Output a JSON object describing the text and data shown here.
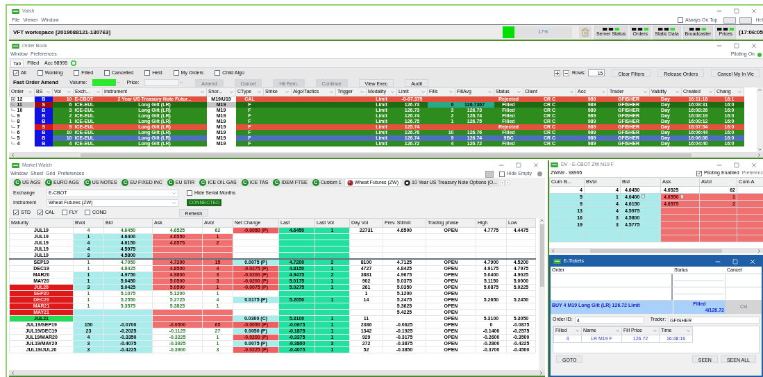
{
  "app": {
    "title": "Vatsh",
    "menu": [
      "File",
      "Viewer",
      "Window"
    ],
    "always_on_top": {
      "label": "Always On Top",
      "checked": false
    },
    "help": "Hel"
  },
  "workspace": {
    "title": "VFT workspace [2019088121-130763]",
    "progress": {
      "level": 0.17,
      "text": "17%"
    },
    "status_buttons": [
      "Server Status",
      "Orders",
      "Static Data",
      "Broadcaster",
      "Prices"
    ],
    "clock": "[17:06:05"
  },
  "order_book": {
    "title": "Order Book",
    "menu": [
      "Window",
      "Preferences"
    ],
    "piloting": "Piloting On",
    "tabs": [
      {
        "label": "Tab",
        "selected": true
      },
      {
        "label": "Filled",
        "selected": false
      },
      {
        "label": "Acc 98995",
        "selected": false
      }
    ],
    "filters": [
      {
        "label": "All",
        "checked": true
      },
      {
        "label": "Working",
        "checked": false
      },
      {
        "label": "Filled",
        "checked": false
      },
      {
        "label": "Cancelled",
        "checked": false
      },
      {
        "label": "Held",
        "checked": false
      },
      {
        "label": "My Orders",
        "checked": false
      },
      {
        "label": "Child Algo",
        "checked": false
      }
    ],
    "rows_label": "Rows:",
    "rows_value": "15",
    "right_buttons": [
      "Clear Filters",
      "Release Orders",
      "Cancel My In Vie"
    ],
    "amend": {
      "title": "Fast Order Amend",
      "volume_label": "Volume:",
      "price_label": "Price:",
      "buttons": [
        {
          "label": "Amend",
          "disabled": true
        },
        {
          "label": "Cancel",
          "disabled": true
        },
        {
          "label": "Hit Rem.",
          "disabled": true
        },
        {
          "label": "Continue",
          "disabled": true
        },
        {
          "label": "View Exec",
          "disabled": false
        },
        {
          "label": "Audit",
          "disabled": false
        }
      ]
    },
    "columns": [
      "Order",
      "BS",
      "Vol",
      "Exch...",
      "Instrument",
      "Shor...",
      "CType",
      "Strike",
      "Algo/Tactics",
      "Trigger",
      "Modality",
      "Limit",
      "Fills",
      "FillAvg",
      "Status",
      "Client",
      "Acc",
      "Trader",
      "Validity",
      "Created",
      "Chang"
    ],
    "rows": [
      {
        "kind": "rejected",
        "selected": false,
        "sell": false,
        "expander": true,
        "order": "12",
        "bs": "B",
        "vol": "10",
        "exch": "E-CBOT",
        "instrument": "2 Year US Treasury Note Futur...",
        "short": "M19/U19",
        "ctype": "CAL",
        "modality": "Limit",
        "limit": "-0-07.375",
        "status": "Rejected",
        "client": "CR C",
        "acc": "989",
        "trader": "GFISHER",
        "validity": "Day",
        "created": "16:11:18",
        "changed": "16:1"
      },
      {
        "kind": "filled",
        "selected": true,
        "sell": true,
        "expander": false,
        "order": "11",
        "bs": "S",
        "vol": "6",
        "exch": "ICE-EUL",
        "instrument": "Long Gilt (LR)",
        "short": "M19",
        "ctype": "F",
        "modality": "Limit",
        "limit": "126.73",
        "fills": "6",
        "fill_avg": "126.7367",
        "status": "Filled",
        "client": "CR C",
        "acc": "989",
        "trader": "GFISHER",
        "validity": "Day",
        "created": "16:08:31",
        "changed": "16:0"
      },
      {
        "kind": "filled",
        "selected": false,
        "sell": false,
        "expander": false,
        "order": "10",
        "bs": "B",
        "vol": "3",
        "exch": "ICE-EUL",
        "instrument": "Long Gilt (LR)",
        "short": "M19",
        "ctype": "F",
        "modality": "Limit",
        "limit": "126.73",
        "fills": "3",
        "fill_avg": "126.73",
        "status": "Filled",
        "client": "CR C",
        "acc": "989",
        "trader": "GFISHER",
        "validity": "Day",
        "created": "16:08:26",
        "changed": "16:0"
      },
      {
        "kind": "filled",
        "selected": false,
        "sell": false,
        "expander": false,
        "order": "9",
        "bs": "B",
        "vol": "2",
        "exch": "ICE-EUL",
        "instrument": "Long Gilt (LR)",
        "short": "M19",
        "ctype": "F",
        "modality": "Limit",
        "limit": "126.74",
        "fills": "2",
        "fill_avg": "126.74",
        "status": "Filled",
        "client": "CR C",
        "acc": "989",
        "trader": "GFISHER",
        "validity": "Day",
        "created": "16:08:19",
        "changed": "16:0"
      },
      {
        "kind": "filled",
        "selected": false,
        "sell": false,
        "expander": false,
        "order": "8",
        "bs": "B",
        "vol": "1",
        "exch": "ICE-EUL",
        "instrument": "Long Gilt (LR)",
        "short": "M19",
        "ctype": "F",
        "modality": "Limit",
        "limit": "126.75",
        "fills": "1",
        "fill_avg": "126.75",
        "status": "Filled",
        "client": "CR C",
        "acc": "989",
        "trader": "GFISHER",
        "validity": "Day",
        "created": "16:08:12",
        "changed": "16:0"
      },
      {
        "kind": "rejected",
        "selected": false,
        "sell": true,
        "expander": false,
        "order": "7",
        "bs": "S",
        "vol": "9",
        "exch": "ICE-EUL",
        "instrument": "Long Gilt (LR)",
        "short": "M19",
        "ctype": "F",
        "modality": "Limit",
        "limit": "125.74",
        "status": "Rejected",
        "client": "CR C",
        "acc": "989",
        "trader": "GFISHER",
        "validity": "Day",
        "created": "16:07:54",
        "changed": "16:0"
      },
      {
        "kind": "filled",
        "selected": false,
        "sell": false,
        "expander": false,
        "order": "6",
        "bs": "B",
        "vol": "10",
        "exch": "ICE-EUL",
        "instrument": "Long Gilt (LR)",
        "short": "M19",
        "ctype": "F",
        "modality": "Limit",
        "limit": "126.76",
        "fills": "10",
        "fill_avg": "126.76",
        "status": "Filled",
        "client": "CR C",
        "acc": "989",
        "trader": "GFISHER",
        "validity": "Day",
        "created": "16:06:44",
        "changed": "16:0"
      },
      {
        "kind": "working",
        "selected": false,
        "sell": false,
        "expander": false,
        "order": "5",
        "bs": "B",
        "vol": "10",
        "exch": "ICE-EUL",
        "instrument": "Long Gilt (LR)",
        "short": "M19",
        "ctype": "F",
        "modality": "Limit",
        "limit": "126.74",
        "fills": "9",
        "fill_avg": "126.74",
        "status": "9BC",
        "client": "CR C",
        "acc": "989",
        "trader": "GFISHER",
        "validity": "Day",
        "created": "16:06:08",
        "changed": "16:0"
      },
      {
        "kind": "filled",
        "selected": false,
        "sell": false,
        "expander": false,
        "order": "4",
        "bs": "B",
        "vol": "4",
        "exch": "ICE-EUL",
        "instrument": "Long Gilt (LR)",
        "short": "M19",
        "ctype": "F",
        "modality": "Limit",
        "limit": "126.72",
        "fills": "4",
        "fill_avg": "126.72",
        "status": "Filled",
        "client": "CR C",
        "acc": "989",
        "trader": "GFISHER",
        "validity": "Day",
        "created": "16:04:40",
        "changed": "16:0"
      }
    ]
  },
  "market_watch": {
    "title": "Market Watch",
    "menu": [
      "Window",
      "Sheet",
      "Grid",
      "Preferences"
    ],
    "hide_empty": {
      "label": "Hide Empty",
      "checked": false
    },
    "tabs": [
      {
        "kind": "letter",
        "badge": "C",
        "label": "US AGS",
        "selected": false
      },
      {
        "kind": "letter",
        "badge": "C",
        "label": "EURO AGS",
        "selected": false
      },
      {
        "kind": "letter",
        "badge": "C",
        "label": "US NOTES",
        "selected": false
      },
      {
        "kind": "letter",
        "badge": "C",
        "label": "EU FIXED INC",
        "selected": false
      },
      {
        "kind": "letter",
        "badge": "C",
        "label": "EU STIR",
        "selected": false
      },
      {
        "kind": "letter",
        "badge": "C",
        "label": "ICE OIL GAS",
        "selected": false
      },
      {
        "kind": "letter",
        "badge": "C",
        "label": "ICE TAS",
        "selected": false
      },
      {
        "kind": "letter",
        "badge": "C",
        "label": "IDEM FTSE",
        "selected": false
      },
      {
        "kind": "letter",
        "badge": "C",
        "label": "Custom 1",
        "selected": false
      },
      {
        "kind": "ball",
        "label": "Wheat Futures (ZW)",
        "selected": true
      },
      {
        "kind": "dot",
        "label": "10 Year US Treasury Note Options (O...",
        "selected": false
      }
    ],
    "exchange_label": "Exchange",
    "exchange": "E-CBOT",
    "instrument_label": "Instrument",
    "instrument": "Wheat Futures (ZW)",
    "hide_serial": {
      "label": "Hide Serial Months",
      "checked": false
    },
    "connection": "CONNECTED",
    "types": [
      {
        "label": "STD",
        "checked": true
      },
      {
        "label": "CAL",
        "checked": true
      },
      {
        "label": "FLY",
        "checked": false
      },
      {
        "label": "COND",
        "checked": false
      }
    ],
    "refresh": "Refresh",
    "columns": [
      "Maturity",
      "BVol",
      "Bid",
      "Ask",
      "AVol",
      "Net Change",
      "Last",
      "Last Vol",
      "Day Vol",
      "Prev. Stlmnt",
      "Trading phase",
      "High",
      "Low"
    ],
    "groups": [
      {
        "rows": [
          {
            "alert": false,
            "new": false,
            "bid_highlight": false,
            "ask_highlight": false,
            "net_up": false,
            "net_down": true,
            "maturity": "JUL19",
            "bvol": "4",
            "bid": "4.6450",
            "ask": "4.6525",
            "avol": "62",
            "net": "-0.0050 (P)",
            "last": "4.6450",
            "last_vol": "1",
            "day_vol": "22731",
            "prev": "4.6500",
            "phase": "OPEN",
            "high": "4.7775",
            "low": "4.4475"
          },
          {
            "alert": false,
            "new": false,
            "bid_highlight": true,
            "ask_highlight": true,
            "net_up": false,
            "net_down": false,
            "maturity": "JUL19",
            "bvol": "1",
            "bid": "4.6400",
            "ask": "4.6550",
            "avol": "1"
          },
          {
            "alert": false,
            "new": false,
            "bid_highlight": true,
            "ask_highlight": true,
            "net_up": false,
            "net_down": false,
            "maturity": "JUL19",
            "bvol": "4",
            "bid": "4.6150",
            "ask": "4.6575",
            "avol": "2"
          },
          {
            "alert": false,
            "new": false,
            "bid_highlight": true,
            "ask_highlight": true,
            "net_up": false,
            "net_down": false,
            "maturity": "JUL19",
            "bvol": "4",
            "bid": "4.5975"
          },
          {
            "alert": false,
            "new": false,
            "bid_highlight": true,
            "ask_highlight": true,
            "net_up": false,
            "net_down": false,
            "maturity": "JUL19",
            "bvol": "3",
            "bid": "4.5800"
          }
        ]
      },
      {
        "rows": [
          {
            "alert": false,
            "new": false,
            "bid_highlight": false,
            "ask_highlight": true,
            "net_up": true,
            "net_down": false,
            "maturity": "SEP19",
            "bvol": "1",
            "bid": "4.7050",
            "ask": "4.7200",
            "avol": "15",
            "net": "0.0075 (P)",
            "last": "4.7200",
            "last_vol": "2",
            "day_vol": "8100",
            "prev": "4.7125",
            "phase": "OPEN",
            "high": "4.7900",
            "low": "4.5200"
          },
          {
            "alert": false,
            "new": false,
            "bid_highlight": false,
            "ask_highlight": true,
            "net_up": false,
            "net_down": true,
            "maturity": "DEC19",
            "bvol": "1",
            "bid": "4.8425",
            "ask": "4.8500",
            "avol": "4",
            "net": "-0.0275 (P)",
            "last": "4.8150",
            "last_vol": "1",
            "day_vol": "4727",
            "prev": "4.8425",
            "phase": "OPEN",
            "high": "4.9175",
            "low": "4.7975"
          },
          {
            "alert": false,
            "new": false,
            "bid_highlight": true,
            "ask_highlight": true,
            "net_up": false,
            "net_down": true,
            "maturity": "MAR20",
            "bvol": "1",
            "bid": "4.9750",
            "ask": "4.9800",
            "avol": "3",
            "net": "-0.0200 (P)",
            "last": "4.9475",
            "last_vol": "2",
            "day_vol": "3881",
            "prev": "4.9675",
            "phase": "OPEN",
            "high": "5.0400",
            "low": "4.9025"
          },
          {
            "alert": false,
            "new": false,
            "bid_highlight": true,
            "ask_highlight": true,
            "net_up": false,
            "net_down": true,
            "maturity": "MAY20",
            "bvol": "1",
            "bid": "5.0450",
            "ask": "5.0500",
            "avol": "3",
            "net": "-0.0200 (P)",
            "last": "5.0175",
            "last_vol": "1",
            "day_vol": "902",
            "prev": "5.0375",
            "phase": "OPEN",
            "high": "5.1150",
            "low": "5.0000"
          },
          {
            "alert": true,
            "new": false,
            "bid_highlight": true,
            "ask_highlight": true,
            "net_up": false,
            "net_down": true,
            "maturity": "JUL20",
            "bvol": "3",
            "bid": "5.0425",
            "ask": "5.0500",
            "avol": "1",
            "net": "-0.0075 (P)",
            "last": "5.0275",
            "last_vol": "1",
            "day_vol": "261",
            "prev": "5.0350",
            "phase": "OPEN",
            "high": "5.0875",
            "low": "5.0225"
          },
          {
            "alert": true,
            "new": false,
            "bid_highlight": false,
            "ask_highlight": false,
            "net_up": false,
            "net_down": false,
            "maturity": "SEP20",
            "bvol": "1",
            "bid": "5.1075",
            "ask": "5.1200",
            "avol": "1",
            "day_vol": "1",
            "prev": "5.1200",
            "phase": "OPEN"
          },
          {
            "alert": true,
            "new": false,
            "bid_highlight": false,
            "ask_highlight": false,
            "net_up": true,
            "net_down": false,
            "maturity": "DEC20",
            "bvol": "1",
            "bid": "5.2550",
            "ask": "5.2725",
            "avol": "4",
            "net": "0.0175 (P)",
            "last": "5.2650",
            "last_vol": "1",
            "day_vol": "14",
            "prev": "5.2475",
            "phase": "OPEN",
            "high": "5.2650",
            "low": "5.2450"
          },
          {
            "alert": true,
            "new": false,
            "bid_highlight": false,
            "ask_highlight": false,
            "net_up": false,
            "net_down": false,
            "maturity": "MAR21",
            "bvol": "1",
            "bid": "5.3575",
            "ask": "5.3825",
            "avol": "1",
            "prev": "5.3625",
            "phase": "OPEN"
          },
          {
            "alert": true,
            "new": false,
            "bid_highlight": true,
            "ask_highlight": true,
            "net_up": false,
            "net_down": false,
            "maturity": "MAY21",
            "prev": "5.4225",
            "phase": "OPEN"
          },
          {
            "alert": false,
            "new": true,
            "bid_highlight": true,
            "ask_highlight": true,
            "net_up": true,
            "net_down": false,
            "maturity": "JUL21",
            "net": "0.0300 (C)",
            "last": "5.3100",
            "last_vol": "1",
            "day_vol": "11",
            "phase": "OPEN",
            "high": "5.3100",
            "low": "5.3050"
          },
          {
            "alert": false,
            "new": false,
            "bid_highlight": true,
            "ask_highlight": true,
            "net_up": false,
            "net_down": true,
            "maturity": "JUL19/SEP19",
            "bvol": "150",
            "bid": "-0.0700",
            "ask": "-0.0500",
            "avol": "65",
            "net": "-0.0050 (P)",
            "last": "-0.0675",
            "last_vol": "1",
            "day_vol": "2386",
            "prev": "-0.0625",
            "phase": "OPEN",
            "high": "0",
            "low": "-0.0875"
          },
          {
            "alert": false,
            "new": false,
            "bid_highlight": true,
            "ask_highlight": false,
            "net_up": true,
            "net_down": false,
            "maturity": "JUL19/DEC19",
            "bvol": "23",
            "bid": "-0.2025",
            "ask": "-0.1125",
            "avol": "27",
            "net": "0.0050 (P)",
            "last": "-0.1875",
            "last_vol": "1",
            "day_vol": "1342",
            "prev": "-0.1925",
            "phase": "OPEN",
            "high": "-0.1400",
            "low": "-0.2575"
          },
          {
            "alert": false,
            "new": false,
            "bid_highlight": true,
            "ask_highlight": false,
            "net_up": false,
            "net_down": true,
            "maturity": "JUL19/MAR20",
            "bvol": "4",
            "bid": "-0.3350",
            "ask": "-0.3225",
            "avol": "1",
            "net": "-0.0200 (P)",
            "last": "-0.3375",
            "last_vol": "1",
            "day_vol": "929",
            "prev": "-0.3175",
            "phase": "OPEN",
            "high": "-0.2600",
            "low": "-0.3500"
          },
          {
            "alert": false,
            "new": false,
            "bid_highlight": true,
            "ask_highlight": false,
            "net_up": true,
            "net_down": false,
            "maturity": "JUL19/MAY20",
            "bvol": "3",
            "bid": "-0.4075",
            "ask": "-0.3925",
            "avol": "1",
            "net": "0.0075 (P)",
            "last": "-0.3800",
            "last_vol": "3",
            "day_vol": "272",
            "prev": "-0.3875",
            "phase": "OPEN",
            "high": "-0.2800",
            "low": "-0.4225"
          },
          {
            "alert": false,
            "new": false,
            "bid_highlight": true,
            "ask_highlight": false,
            "net_up": false,
            "net_down": true,
            "maturity": "JUL19/JUL20",
            "bvol": "3",
            "bid": "-0.4225",
            "ask": "-0.3900",
            "avol": "3",
            "net": "-0.0225 (P)",
            "last": "-0.4075",
            "last_vol": "1",
            "day_vol": "52",
            "prev": "-0.3850",
            "phase": "OPEN",
            "high": "-0.3700",
            "low": "-0.4500"
          }
        ]
      }
    ]
  },
  "depth": {
    "title": "DV - E-CBOT ZW N19 F",
    "account": "ZWN9 - 98995",
    "piloting": {
      "label": "Piloting Enabled",
      "checked": true
    },
    "preferences": "Preferenc",
    "columns": [
      "Cum B...",
      "BVol",
      "Bid",
      "Ask",
      "AVol",
      "Cum A"
    ],
    "rows": [
      {
        "highlight": false,
        "flagged": false,
        "cum_bid": "4",
        "bvol": "4",
        "bid": "4.6450",
        "ask": "4.6525",
        "avol": "62"
      },
      {
        "highlight": true,
        "flagged": true,
        "cum_bid": "5",
        "bvol": "1",
        "bid": "4.6400",
        "ask": "4.6550",
        "avol": "1"
      },
      {
        "highlight": true,
        "flagged": false,
        "cum_bid": "9",
        "bvol": "4",
        "bid": "4.6150",
        "ask": "4.6575",
        "avol": "2"
      },
      {
        "highlight": true,
        "flagged": false,
        "cum_bid": "13",
        "bvol": "4",
        "bid": "4.5975"
      },
      {
        "highlight": true,
        "flagged": false,
        "cum_bid": "16",
        "bvol": "3",
        "bid": "4.5800"
      },
      {
        "highlight": true,
        "flagged": false,
        "cum_bid": "19",
        "bvol": "3",
        "bid": "4.5775"
      },
      {
        "highlight": true,
        "flagged": false
      },
      {
        "highlight": true,
        "flagged": false
      }
    ]
  },
  "tickets": {
    "title": "E-Tickets",
    "columns": [
      "Order",
      "Status",
      "Cancel"
    ],
    "items": [
      {
        "order": "BUY 4 M19 Long Gilt (LR) 126.72 Limit",
        "status": "Filled",
        "detail": "4/126.72",
        "cancel": "Cxl",
        "cancel_disabled": true
      }
    ],
    "order_id_label": "Order ID:",
    "order_id": "4",
    "trader_label": "Trader:",
    "trader": "GFISHER",
    "fill_columns": [
      "Filled",
      "Name",
      "Fill Price",
      "Time"
    ],
    "fills": [
      [
        "4",
        "LR M19 F",
        "126.72",
        "16:48:16"
      ]
    ],
    "buttons": [
      "GOTO",
      "SEEN",
      "SEEN ALL"
    ]
  }
}
